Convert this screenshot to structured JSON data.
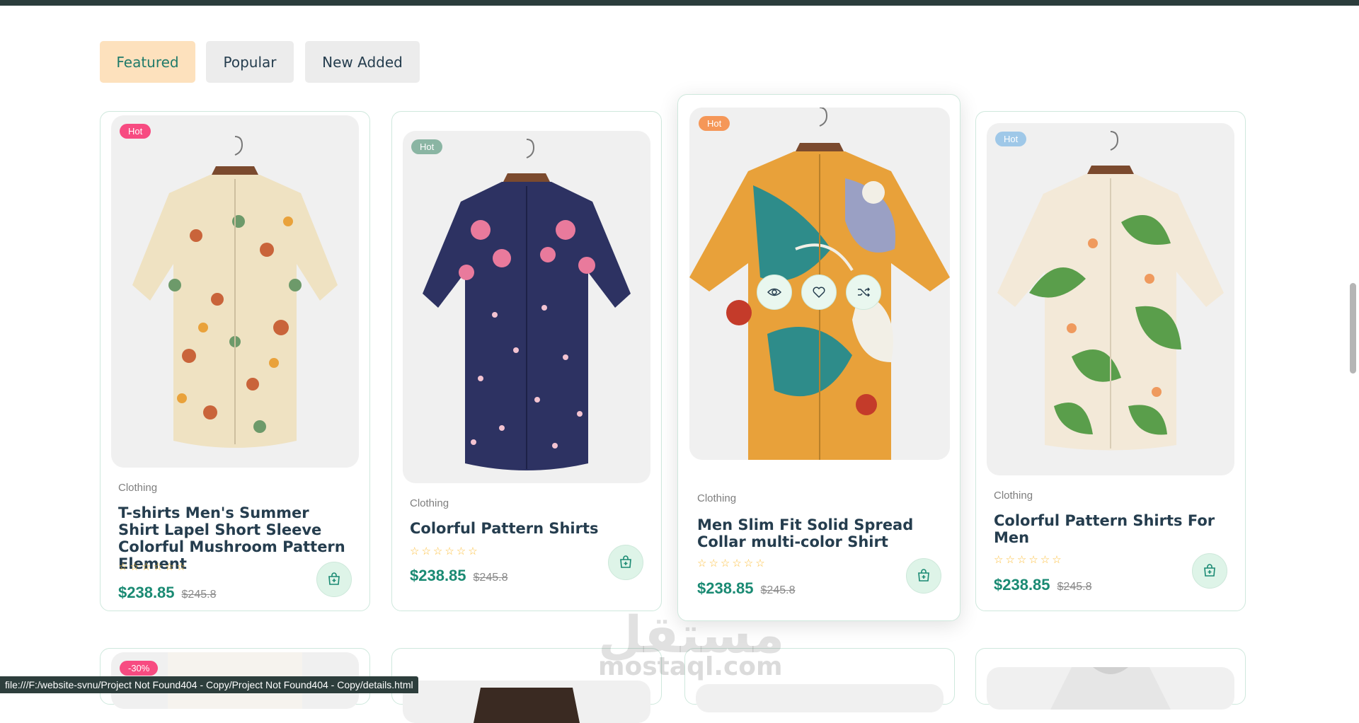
{
  "tabs": [
    {
      "label": "Featured",
      "active": true
    },
    {
      "label": "Popular",
      "active": false
    },
    {
      "label": "New Added",
      "active": false
    }
  ],
  "products": [
    {
      "badge": "Hot",
      "badge_color": "#f74b81",
      "category": "Clothing",
      "title": "T-shirts Men's Summer Shirt Lapel Short Sleeve Colorful Mushroom Pattern Element",
      "rating": "☆☆☆☆☆☆",
      "price": "$238.85",
      "old_price": "$245.8",
      "shirt": "mushroom"
    },
    {
      "badge": "Hot",
      "badge_color": "#8ab5a3",
      "category": "Clothing",
      "title": "Colorful Pattern Shirts",
      "rating": "☆☆☆☆☆☆",
      "price": "$238.85",
      "old_price": "$245.8",
      "shirt": "navy-floral"
    },
    {
      "badge": "Hot",
      "badge_color": "#f59758",
      "category": "Clothing",
      "title": "Men Slim Fit Solid Spread Collar multi-color Shirt",
      "rating": "☆☆☆☆☆☆",
      "price": "$238.85",
      "old_price": "$245.8",
      "shirt": "abstract"
    },
    {
      "badge": "Hot",
      "badge_color": "#9fc8e8",
      "category": "Clothing",
      "title": "Colorful Pattern Shirts For Men",
      "rating": "☆☆☆☆☆☆",
      "price": "$238.85",
      "old_price": "$245.8",
      "shirt": "tropical"
    }
  ],
  "next_row": [
    {
      "badge": "-30%",
      "badge_color": "#f74b81"
    }
  ],
  "hover_actions": [
    "eye-icon",
    "heart-icon",
    "shuffle-icon"
  ],
  "watermark": {
    "arabic": "مستقل",
    "latin": "mostaql.com"
  },
  "status_url": "file:///F:/website-svnu/Project Not Found404 - Copy/Project Not Found404 - Copy/details.html"
}
